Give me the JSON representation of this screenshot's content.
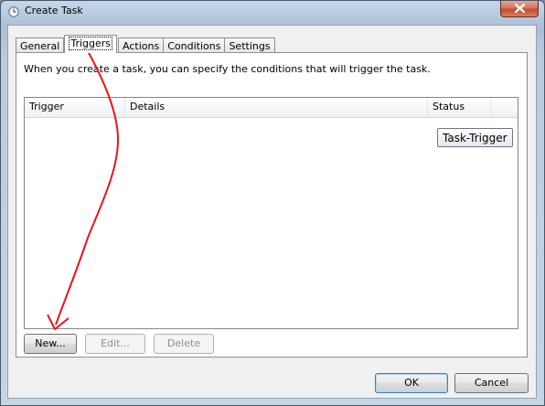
{
  "window": {
    "title": "Create Task",
    "close_symbol": "×",
    "title_icon": "clock-icon"
  },
  "tabs": [
    {
      "label": "General",
      "active": false
    },
    {
      "label": "Triggers",
      "active": true
    },
    {
      "label": "Actions",
      "active": false
    },
    {
      "label": "Conditions",
      "active": false
    },
    {
      "label": "Settings",
      "active": false
    }
  ],
  "triggers_panel": {
    "description": "When you create a task, you can specify the conditions that will trigger the task.",
    "columns": [
      "Trigger",
      "Details",
      "Status"
    ],
    "rows": [],
    "tooltip": "Task-Trigger",
    "buttons": {
      "new": "New...",
      "edit": "Edit...",
      "delete": "Delete"
    }
  },
  "footer": {
    "ok": "OK",
    "cancel": "Cancel"
  },
  "colors": {
    "annotation_arrow": "#e8141b",
    "close_button": "#c24a31"
  },
  "annotation": "red arrow pointing from Triggers tab to New button"
}
